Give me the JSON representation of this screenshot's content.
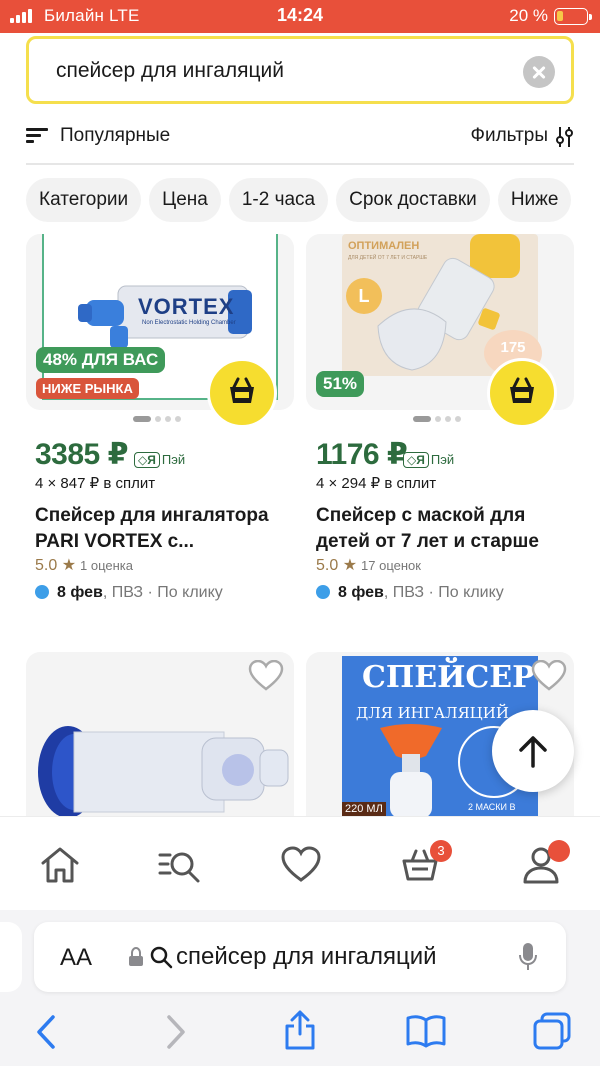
{
  "status_bar": {
    "carrier": "Билайн  LTE",
    "time": "14:24",
    "battery": "20 %"
  },
  "search": {
    "query": "спейсер для ингаляций"
  },
  "sort": {
    "label": "Популярные",
    "filters_label": "Фильтры"
  },
  "chips": [
    "Категории",
    "Цена",
    "1-2 часа",
    "Срок доставки",
    "Ниже"
  ],
  "products": [
    {
      "price": "3385 ₽",
      "pay": "Пэй",
      "split": "4 × 847 ₽  в сплит",
      "title": "Спейсер для ингалятора PARI VORTEX с...",
      "rating": "5.0 ★",
      "reviews": "1 оценка",
      "delivery_date": "8 фев",
      "delivery_rest": ", ПВЗ · По клику",
      "discount_badge": "48% ДЛЯ ВАС",
      "market_badge": "НИЖЕ РЫНКА",
      "image_brand": "VORTEX",
      "image_caption": "Non Electrostatic Holding Chamber"
    },
    {
      "price": "1176 ₽",
      "pay": "Пэй",
      "split": "4 × 294 ₽  в сплит",
      "title": "Спейсер с маской для детей от 7 лет и старше",
      "rating": "5.0 ★",
      "reviews": "17 оценок",
      "delivery_date": "8 фев",
      "delivery_rest": ", ПВЗ · По клику",
      "discount_badge": "51%",
      "image_brand": "ОПТИМАЛЕН",
      "image_caption": "ДЛЯ ДЕТЕЙ ОТ 7 ЛЕТ И СТАРШЕ",
      "image_letter": "L",
      "image_volume": "175"
    },
    {},
    {
      "image_title": "СПЕЙСЕР",
      "image_subtitle": "ДЛЯ ИНГАЛЯЦИЙ",
      "image_volume": "220 МЛ",
      "image_masks": "2 МАСКИ В"
    }
  ],
  "bottom_nav": {
    "cart_count": "3"
  },
  "safari": {
    "aa": "AA",
    "url": "спейсер для ингаляций"
  },
  "colors": {
    "accent": "#e8503a",
    "yellow": "#f6dd2f",
    "price_green": "#2d6b3e"
  }
}
